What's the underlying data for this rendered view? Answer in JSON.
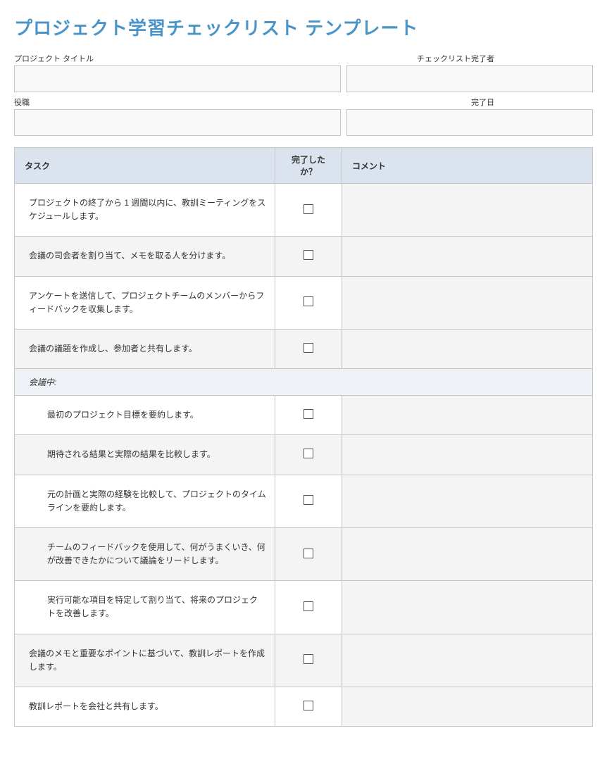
{
  "title": "プロジェクト学習チェックリスト テンプレート",
  "meta": {
    "project_title_label": "プロジェクト タイトル",
    "completed_by_label": "チェックリスト完了者",
    "role_label": "役職",
    "completion_date_label": "完了日"
  },
  "headers": {
    "task": "タスク",
    "done": "完了したか？",
    "comment": "コメント"
  },
  "section_label": "会議中:",
  "tasks_pre": [
    "プロジェクトの終了から 1 週間以内に、教訓ミーティングをスケジュールします。",
    "会議の司会者を割り当て、メモを取る人を分けます。",
    "アンケートを送信して、プロジェクトチームのメンバーからフィードバックを収集します。",
    "会議の議題を作成し、参加者と共有します。"
  ],
  "tasks_meeting": [
    "最初のプロジェクト目標を要約します。",
    "期待される結果と実際の結果を比較します。",
    "元の計画と実際の経験を比較して、プロジェクトのタイムラインを要約します。",
    "チームのフィードバックを使用して、何がうまくいき、何が改善できたかについて議論をリードします。",
    "実行可能な項目を特定して割り当て、将来のプロジェクトを改善します。"
  ],
  "tasks_post": [
    "会議のメモと重要なポイントに基づいて、教訓レポートを作成します。",
    "教訓レポートを会社と共有します。"
  ]
}
